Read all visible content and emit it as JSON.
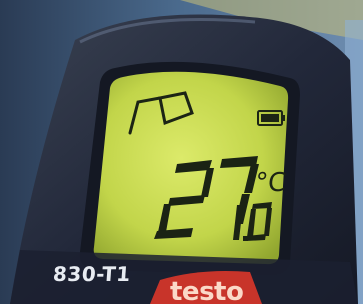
{
  "device": {
    "model": "830-T1",
    "brand": "testo"
  },
  "display": {
    "temperature_main": "27",
    "temperature_sub": "1.0",
    "unit": "°C",
    "battery_level": 1.0,
    "icons": [
      "laser-target-icon",
      "battery-icon"
    ]
  },
  "colors": {
    "lcd_backlight": "#c8dc4a",
    "bezel": "#2b3140",
    "brand_red": "#c8342a"
  }
}
